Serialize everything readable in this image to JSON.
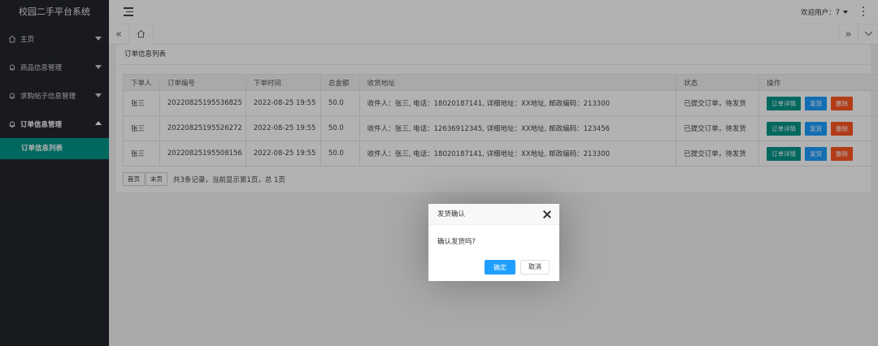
{
  "app": {
    "title": "校园二手平台系统"
  },
  "sidebar": {
    "items": [
      {
        "label": "主页",
        "icon": "home-icon",
        "expanded": false
      },
      {
        "label": "商品信息管理",
        "icon": "bell-icon",
        "expanded": false
      },
      {
        "label": "求购帖子信息管理",
        "icon": "bell-icon",
        "expanded": false
      },
      {
        "label": "订单信息管理",
        "icon": "bell-icon",
        "expanded": true
      }
    ],
    "sub_items": [
      {
        "label": "订单信息列表",
        "active": true
      }
    ]
  },
  "header": {
    "welcome": "欢迎用户：7"
  },
  "tabs": {
    "prev": "«",
    "next": "»"
  },
  "page": {
    "title": "订单信息列表"
  },
  "table": {
    "columns": [
      "下单人",
      "订单编号",
      "下单时间",
      "总金额",
      "收货地址",
      "状态",
      "操作"
    ],
    "rows": [
      {
        "buyer": "张三",
        "order_no": "20220825195536825",
        "time": "2022-08-25 19:55",
        "amount": "50.0",
        "address": "收件人：张三, 电话：18020187141, 详细地址：XX地址, 邮政编码：213300",
        "status": "已提交订单，待发货"
      },
      {
        "buyer": "张三",
        "order_no": "20220825195526272",
        "time": "2022-08-25 19:55",
        "amount": "50.0",
        "address": "收件人：张三, 电话：12636912345, 详细地址：XX地址, 邮政编码：123456",
        "status": "已提交订单，待发货"
      },
      {
        "buyer": "张三",
        "order_no": "20220825195508156",
        "time": "2022-08-25 19:55",
        "amount": "50.0",
        "address": "收件人：张三, 电话：18020187141, 详细地址：XX地址, 邮政编码：213300",
        "status": "已提交订单，待发货"
      }
    ],
    "actions": {
      "detail": "订单详情",
      "ship": "发货",
      "delete": "删除"
    }
  },
  "pager": {
    "first": "首页",
    "last": "末页",
    "info": "共3条记录，当前显示第1页，总 1页"
  },
  "dialog": {
    "title": "发货确认",
    "message": "确认发货吗?",
    "ok": "确定",
    "cancel": "取消"
  },
  "colors": {
    "sidebar": "#23262e",
    "accent": "#009688",
    "primary": "#1e9fff",
    "danger": "#ff5722"
  }
}
